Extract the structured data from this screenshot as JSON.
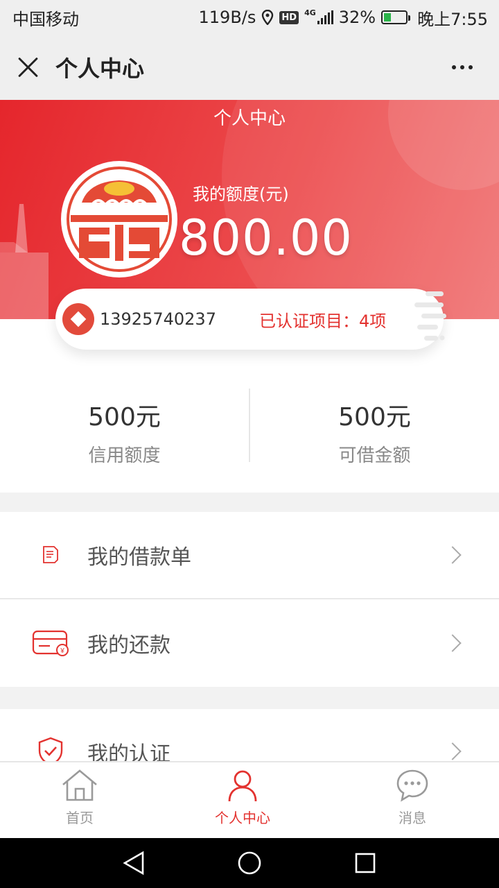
{
  "status_bar": {
    "carrier": "中国移动",
    "speed": "119B/s",
    "hd": "HD",
    "network": "4G",
    "battery": "32%",
    "battery_level": 0.32,
    "time": "晚上7:55"
  },
  "nav": {
    "title": "个人中心"
  },
  "hero": {
    "title": "个人中心",
    "quota_label": "我的额度(元)",
    "quota_value": "800.00"
  },
  "info_card": {
    "phone": "13925740237",
    "verified": "已认证项目：4项"
  },
  "stats": [
    {
      "value": "500元",
      "label": "信用额度"
    },
    {
      "value": "500元",
      "label": "可借金额"
    }
  ],
  "menu_group_1": [
    {
      "label": "我的借款单",
      "icon": "loan-document-icon"
    },
    {
      "label": "我的还款",
      "icon": "repayment-card-icon"
    }
  ],
  "menu_group_2": [
    {
      "label": "我的认证",
      "icon": "shield-check-icon"
    }
  ],
  "tabs": [
    {
      "label": "首页",
      "icon": "home-icon",
      "active": false
    },
    {
      "label": "个人中心",
      "icon": "user-icon",
      "active": true
    },
    {
      "label": "消息",
      "icon": "message-icon",
      "active": false
    }
  ],
  "colors": {
    "brand_red": "#e3322f",
    "hero_gradient_start": "#e5262c",
    "hero_gradient_end": "#f07474"
  }
}
